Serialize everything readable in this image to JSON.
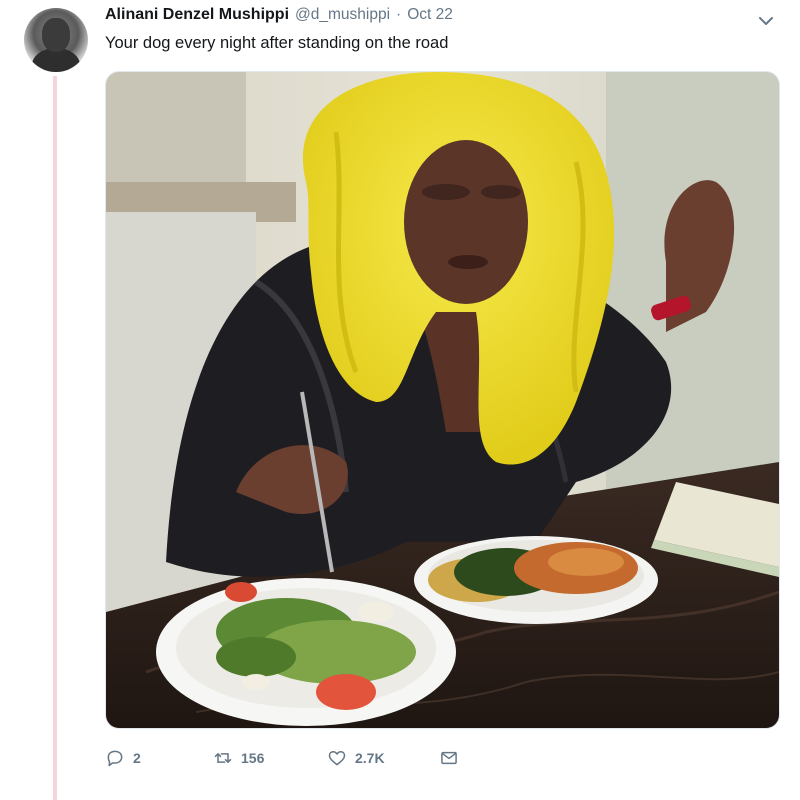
{
  "tweet": {
    "author_name": "Alinani Denzel Mushippi",
    "handle": "@d_mushippi",
    "separator": "·",
    "date": "Oct 22",
    "text": "Your dog every night after standing on the road",
    "media_icon": "photo",
    "avatar_icon": "profile-photo"
  },
  "actions": {
    "reply_count": "2",
    "retweet_count": "156",
    "like_count": "2.7K",
    "reply_icon": "reply-icon",
    "retweet_icon": "retweet-icon",
    "like_icon": "heart-icon",
    "dm_icon": "envelope-icon"
  },
  "colors": {
    "text_primary": "#14171a",
    "text_secondary": "#657786",
    "thread_line": "#f5d4dc",
    "border": "#e1e8ed"
  }
}
